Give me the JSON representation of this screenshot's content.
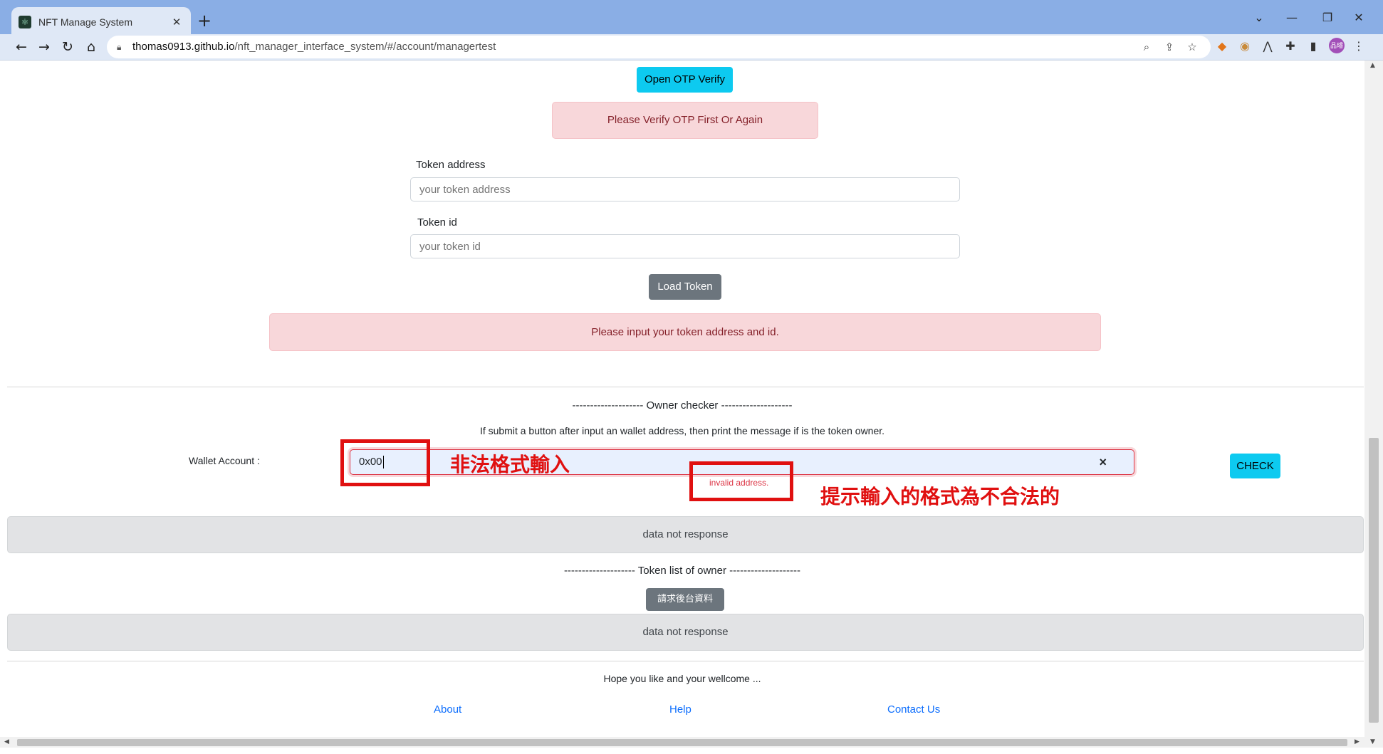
{
  "browser": {
    "tab_title": "NFT Manage System",
    "tab_favicon": "⚛",
    "tab_close": "✕",
    "new_tab": "+",
    "url_host": "thomas0913.github.io",
    "url_path": "/nft_manager_interface_system/#/account/managertest",
    "window_controls": [
      "⌄",
      "—",
      "❐",
      "✕"
    ],
    "nav_icons": [
      "←",
      "→",
      "↻",
      "⌂"
    ],
    "omnibox_icons": [
      "zoom-icon",
      "share-icon",
      "star-icon"
    ],
    "extension_icons": [
      "metamask-icon",
      "extension-icon",
      "extension-icon",
      "puzzle-icon",
      "sidepanel-icon"
    ],
    "avatar_text": "品璿",
    "menu": "⋮"
  },
  "otp": {
    "open_button": "Open OTP Verify",
    "alert": "Please Verify OTP First Or Again"
  },
  "token_form": {
    "address_label": "Token address",
    "address_placeholder": "your token address",
    "id_label": "Token id",
    "id_placeholder": "your token id",
    "load_button": "Load Token",
    "alert": "Please input your token address and id."
  },
  "owner_checker": {
    "heading": "-------------------- Owner checker --------------------",
    "description": "If submit a button after input an wallet address, then print the message if is the token owner.",
    "wallet_label": "Wallet Account :",
    "wallet_value": "0x00",
    "clear_icon": "×",
    "error": "invalid address.",
    "check_button": "CHECK",
    "result": "data not response"
  },
  "token_list": {
    "heading": "-------------------- Token list of owner --------------------",
    "request_button": "請求後台資料",
    "result": "data not response"
  },
  "footer": {
    "message": "Hope you like and your wellcome ...",
    "links": [
      "About",
      "Help",
      "Contact Us"
    ]
  },
  "annotations": {
    "illegal_format": "非法格式輸入",
    "hint_illegal": "提示輸入的格式為不合法的",
    "color": "#e01010"
  },
  "colors": {
    "info": "#0dcaf0",
    "secondary": "#6c757d",
    "danger_bg": "#f8d7da",
    "danger_text": "#842029",
    "link": "#0d6efd"
  }
}
